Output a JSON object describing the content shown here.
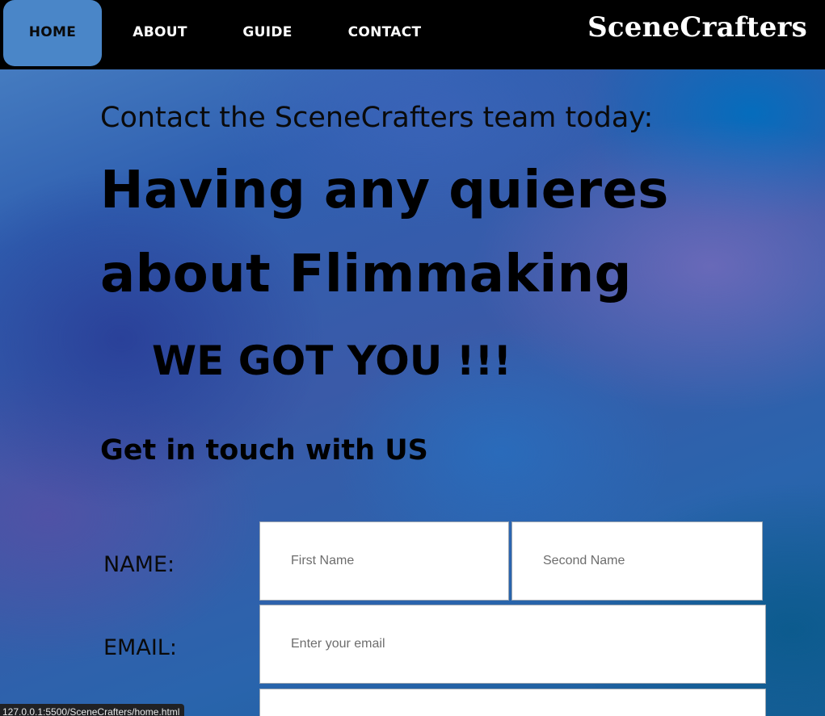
{
  "nav": {
    "items": [
      {
        "label": "HOME",
        "active": true
      },
      {
        "label": "ABOUT",
        "active": false
      },
      {
        "label": "GUIDE",
        "active": false
      },
      {
        "label": "CONTACT",
        "active": false
      }
    ],
    "brand": "SceneCrafters"
  },
  "hero": {
    "contact_line": "Contact the SceneCrafters team today:",
    "headline_line1": "Having any quieres",
    "headline_line2": "about Flimmaking",
    "slogan": "WE GOT YOU !!!",
    "subhead": "Get in touch with US"
  },
  "form": {
    "name_label": "NAME:",
    "email_label": "EMAIL:",
    "first_name_placeholder": "First Name",
    "second_name_placeholder": "Second Name",
    "email_placeholder": "Enter your email"
  },
  "status_bar": {
    "url": "127.0.0.1:5500/SceneCrafters/home.html"
  },
  "colors": {
    "nav_background": "#000000",
    "nav_active_background": "#4a86c8",
    "nav_text": "#ffffff",
    "page_gradient_accent": "#2f5fb0",
    "field_background": "#ffffff"
  }
}
